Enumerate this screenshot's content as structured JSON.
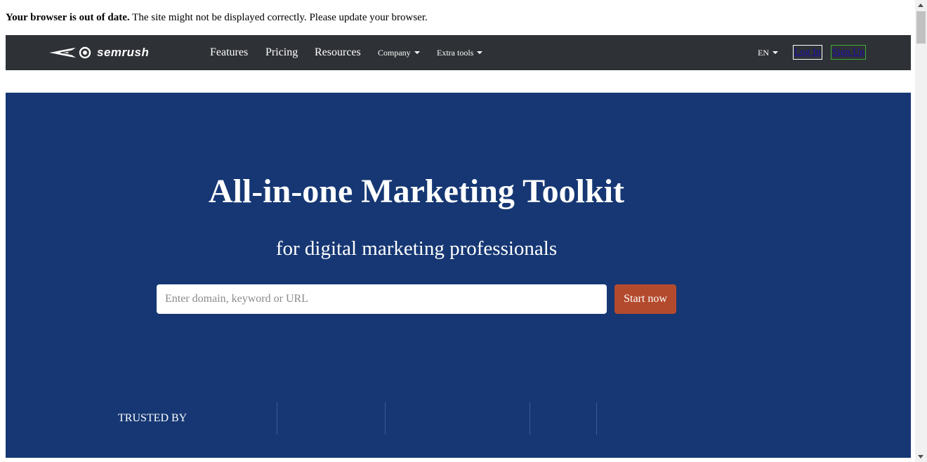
{
  "banner": {
    "bold": "Your browser is out of date.",
    "text": " The site might not be displayed correctly. Please update your browser."
  },
  "nav": {
    "logo_text": "semrush",
    "features": "Features",
    "pricing": "Pricing",
    "resources": "Resources",
    "company": "Company",
    "extra_tools": "Extra tools",
    "language": "EN",
    "login": "Log In",
    "signup": "Sign Up"
  },
  "hero": {
    "title": "All-in-one Marketing Toolkit",
    "subtitle": "for digital marketing professionals",
    "search_placeholder": "Enter domain, keyword or URL",
    "start_button": "Start now",
    "trusted_by": "TRUSTED BY"
  },
  "colors": {
    "navbar": "#2e3135",
    "hero": "#163773",
    "cta": "#b44a2d",
    "signup_border": "#3fae3a"
  }
}
